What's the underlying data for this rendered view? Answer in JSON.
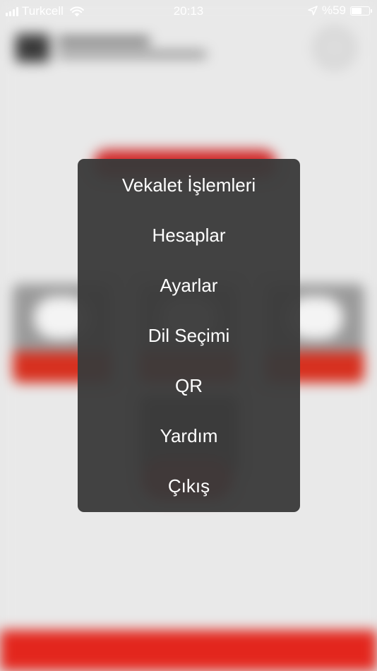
{
  "status_bar": {
    "carrier": "Turkcell",
    "time": "20:13",
    "battery_text": "%59",
    "battery_level": 0.59,
    "icons": [
      "signal-icon",
      "wifi-icon",
      "location-arrow-icon",
      "battery-icon"
    ]
  },
  "menu": {
    "items": [
      {
        "label": "Vekalet İşlemleri"
      },
      {
        "label": "Hesaplar"
      },
      {
        "label": "Ayarlar"
      },
      {
        "label": "Dil Seçimi"
      },
      {
        "label": "QR"
      },
      {
        "label": "Yardım"
      },
      {
        "label": "Çıkış"
      }
    ]
  },
  "colors": {
    "menu_background": "#3a3a3a",
    "menu_text": "#ffffff",
    "accent_red": "#e3261d"
  }
}
